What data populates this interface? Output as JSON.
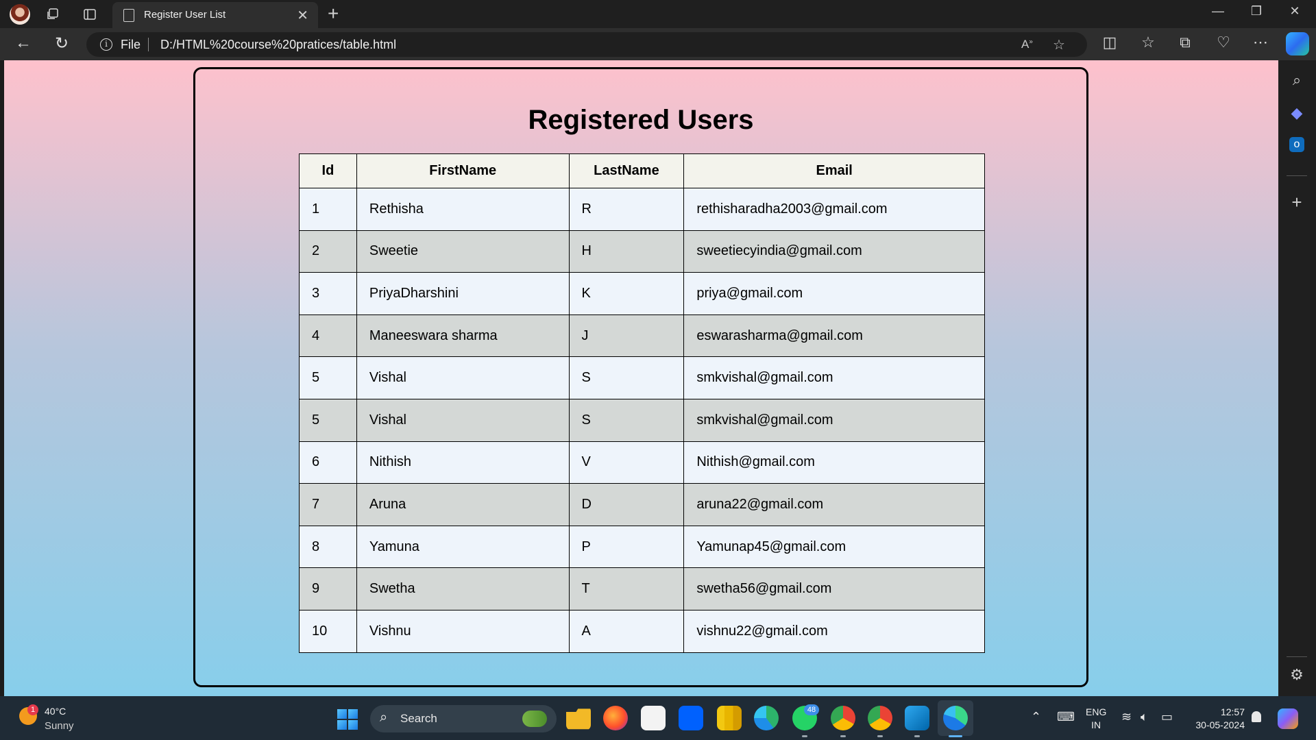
{
  "browser": {
    "tab_title": "Register User List",
    "tab_close": "✕",
    "new_tab": "+",
    "address_scheme": "File",
    "address_url": "D:/HTML%20course%20pratices/table.html"
  },
  "page": {
    "title": "Registered Users",
    "table": {
      "headers": [
        "Id",
        "FirstName",
        "LastName",
        "Email"
      ],
      "rows": [
        [
          "1",
          "Rethisha",
          "R",
          "rethisharadha2003@gmail.com"
        ],
        [
          "2",
          "Sweetie",
          "H",
          "sweetiecyindia@gmail.com"
        ],
        [
          "3",
          "PriyaDharshini",
          "K",
          "priya@gmail.com"
        ],
        [
          "4",
          "Maneeswara sharma",
          "J",
          "eswarasharma@gmail.com"
        ],
        [
          "5",
          "Vishal",
          "S",
          "smkvishal@gmail.com"
        ],
        [
          "5",
          "Vishal",
          "S",
          "smkvishal@gmail.com"
        ],
        [
          "6",
          "Nithish",
          "V",
          "Nithish@gmail.com"
        ],
        [
          "7",
          "Aruna",
          "D",
          "aruna22@gmail.com"
        ],
        [
          "8",
          "Yamuna",
          "P",
          "Yamunap45@gmail.com"
        ],
        [
          "9",
          "Swetha",
          "T",
          "swetha56@gmail.com"
        ],
        [
          "10",
          "Vishnu",
          "A",
          "vishnu22@gmail.com"
        ]
      ]
    }
  },
  "taskbar": {
    "weather_temp": "40°C",
    "weather_desc": "Sunny",
    "weather_badge": "1",
    "search_label": "Search",
    "whatsapp_badge": "48",
    "lang_line1": "ENG",
    "lang_line2": "IN",
    "time": "12:57",
    "date": "30-05-2024"
  },
  "colors": {
    "gradient_top": "#fec1cc",
    "gradient_bottom": "#87ceeb",
    "row_odd": "#eef4fb",
    "row_even": "#d4d8d6",
    "header_bg": "#f3f3ec"
  }
}
